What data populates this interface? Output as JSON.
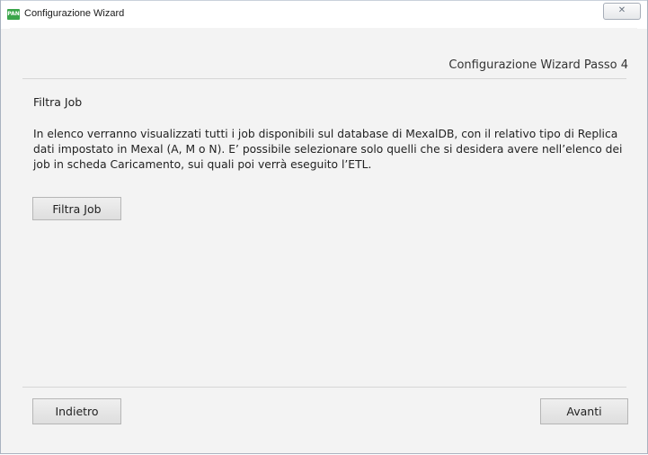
{
  "window": {
    "title": "Configurazione Wizard",
    "icon_label": "PAN",
    "close_symbol": "✕"
  },
  "wizard": {
    "step_title": "Configurazione Wizard Passo 4",
    "section_title": "Filtra Job",
    "description": "In elenco verranno visualizzati tutti i job disponibili sul database di MexalDB, con il relativo tipo di Replica dati impostato in Mexal (A, M o N). E’ possibile selezionare solo quelli che si desidera avere nell’elenco dei job in scheda Caricamento, sui quali poi verrà eseguito l’ETL.",
    "filter_button": "Filtra Job"
  },
  "footer": {
    "back_button": "Indietro",
    "next_button": "Avanti"
  }
}
